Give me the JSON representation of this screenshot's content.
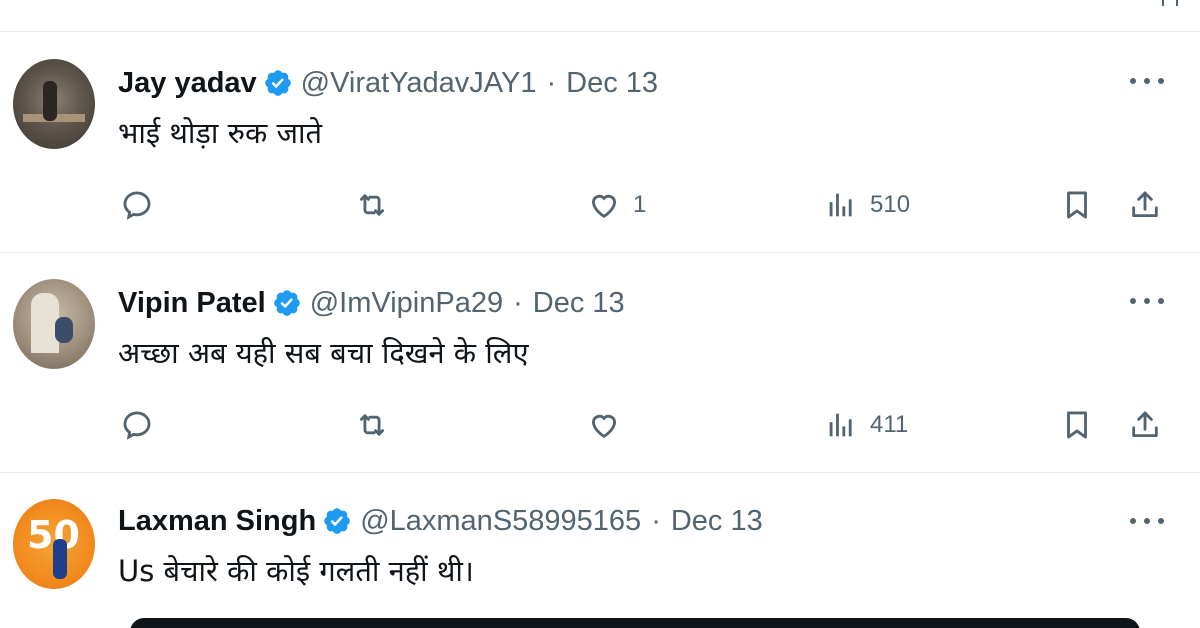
{
  "tweets": [
    {
      "name": "Jay yadav",
      "handle": "@ViratYadavJAY1",
      "separator": "·",
      "date": "Dec 13",
      "text": "भाई थोड़ा रुक जाते",
      "likes": "1",
      "views": "510"
    },
    {
      "name": "Vipin Patel",
      "handle": "@ImVipinPa29",
      "separator": "·",
      "date": "Dec 13",
      "text": "अच्छा अब यही सब बचा दिखने के लिए",
      "likes": "",
      "views": "411"
    },
    {
      "name": "Laxman Singh",
      "handle": "@LaxmanS58995165",
      "separator": "·",
      "date": "Dec 13",
      "text": "Us बेचारे की कोई गलती नहीं थी।",
      "avatar_badge": "50"
    }
  ],
  "colors": {
    "verified": "#1d9bf0",
    "muted": "#536471",
    "text": "#0f1419",
    "divider": "#e6ecf0"
  },
  "icons": [
    "reply-icon",
    "retweet-icon",
    "like-icon",
    "views-icon",
    "bookmark-icon",
    "share-icon",
    "more-icon",
    "verified-badge-icon"
  ]
}
